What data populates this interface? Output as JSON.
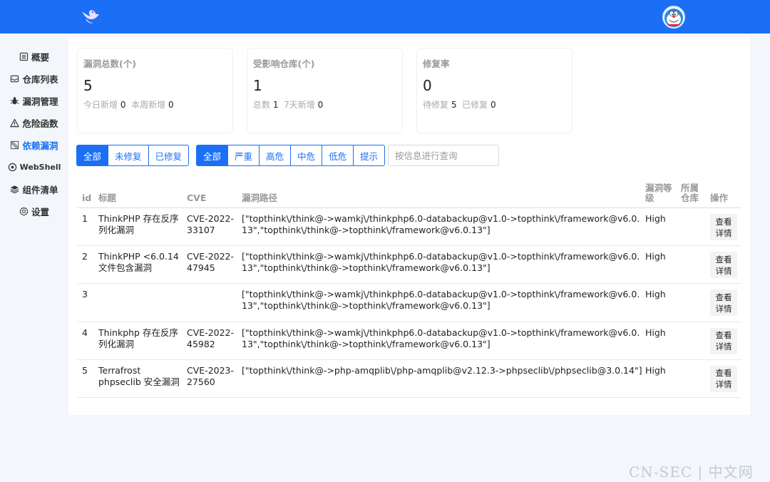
{
  "nav": [
    {
      "label": "概要",
      "icon": "list-icon"
    },
    {
      "label": "仓库列表",
      "icon": "inbox-icon"
    },
    {
      "label": "漏洞管理",
      "icon": "bug-icon"
    },
    {
      "label": "危险函数",
      "icon": "warning-icon"
    },
    {
      "label": "依赖漏洞",
      "icon": "dependency-icon",
      "active": true
    },
    {
      "label": "WebShell",
      "icon": "webshell-icon"
    },
    {
      "label": "组件清单",
      "icon": "layers-icon"
    },
    {
      "label": "设置",
      "icon": "gear-icon"
    }
  ],
  "cards": [
    {
      "title": "漏洞总数(个)",
      "value": "5",
      "sub1_label": "今日新增",
      "sub1_value": "0",
      "sub2_label": "本周新增",
      "sub2_value": "0"
    },
    {
      "title": "受影响仓库(个)",
      "value": "1",
      "sub1_label": "总数",
      "sub1_value": "1",
      "sub2_label": "7天新增",
      "sub2_value": "0"
    },
    {
      "title": "修复率",
      "value": "0",
      "sub1_label": "待修复",
      "sub1_value": "5",
      "sub2_label": "已修复",
      "sub2_value": "0"
    }
  ],
  "status_filter": [
    "全部",
    "未修复",
    "已修复"
  ],
  "level_filter": [
    "全部",
    "严重",
    "高危",
    "中危",
    "低危",
    "提示"
  ],
  "search": {
    "placeholder": "按信息进行查询"
  },
  "table": {
    "headers": {
      "id": "id",
      "title": "标题",
      "cve": "CVE",
      "path": "漏洞路径",
      "level_1": "漏洞等",
      "level_2": "级",
      "repo_1": "所属",
      "repo_2": "仓库",
      "action": "操作"
    },
    "view_label_1": "查看",
    "view_label_2": "详情",
    "rows": [
      {
        "id": "1",
        "title": "ThinkPHP 存在反序列化漏洞",
        "cve": "CVE-2022-33107",
        "path": "[\"topthink\\/think@->wamkj\\/thinkphp6.0-databackup@v1.0->topthink\\/framework@v6.0.13\",\"topthink\\/think@->topthink\\/framework@v6.0.13\"]",
        "level": "High"
      },
      {
        "id": "2",
        "title": "ThinkPHP <6.0.14 文件包含漏洞",
        "cve": "CVE-2022-47945",
        "path": "[\"topthink\\/think@->wamkj\\/thinkphp6.0-databackup@v1.0->topthink\\/framework@v6.0.13\",\"topthink\\/think@->topthink\\/framework@v6.0.13\"]",
        "level": "High"
      },
      {
        "id": "3",
        "title": "",
        "cve": "",
        "path": "[\"topthink\\/think@->wamkj\\/thinkphp6.0-databackup@v1.0->topthink\\/framework@v6.0.13\",\"topthink\\/think@->topthink\\/framework@v6.0.13\"]",
        "level": "High"
      },
      {
        "id": "4",
        "title": "Thinkphp 存在反序列化漏洞",
        "cve": "CVE-2022-45982",
        "path": "[\"topthink\\/think@->wamkj\\/thinkphp6.0-databackup@v1.0->topthink\\/framework@v6.0.13\",\"topthink\\/think@->topthink\\/framework@v6.0.13\"]",
        "level": "High"
      },
      {
        "id": "5",
        "title": "Terrafrost phpseclib 安全漏洞",
        "cve": "CVE-2023-27560",
        "path": "[\"topthink\\/think@->php-amqplib\\/php-amqplib@v2.12.3->phpseclib\\/phpseclib@3.0.14\"]",
        "level": "High"
      }
    ]
  },
  "watermark": "CN-SEC | 中文网"
}
